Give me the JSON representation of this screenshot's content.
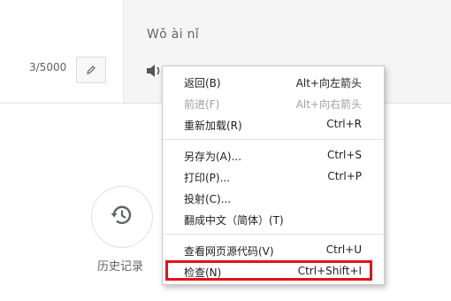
{
  "top": {
    "char_count": "3/5000",
    "pinyin": "Wǒ ài nǐ"
  },
  "icons": {
    "edit": "pencil-icon",
    "speaker": "speaker-icon",
    "history": "history-icon"
  },
  "history": {
    "label": "历史记录"
  },
  "context_menu": {
    "items": [
      {
        "label": "返回(B)",
        "shortcut": "Alt+向左箭头",
        "disabled": false
      },
      {
        "label": "前进(F)",
        "shortcut": "Alt+向右箭头",
        "disabled": true
      },
      {
        "label": "重新加载(R)",
        "shortcut": "Ctrl+R",
        "disabled": false
      },
      {
        "label": "另存为(A)...",
        "shortcut": "Ctrl+S",
        "disabled": false
      },
      {
        "label": "打印(P)...",
        "shortcut": "Ctrl+P",
        "disabled": false
      },
      {
        "label": "投射(C)...",
        "shortcut": "",
        "disabled": false
      },
      {
        "label": "翻成中文（简体）(T)",
        "shortcut": "",
        "disabled": false
      },
      {
        "label": "查看网页源代码(V)",
        "shortcut": "Ctrl+U",
        "disabled": false
      },
      {
        "label": "检查(N)",
        "shortcut": "Ctrl+Shift+I",
        "disabled": false
      }
    ]
  },
  "colors": {
    "highlight": "#e1131a",
    "accent": "#f2c200",
    "panel": "#f5f5f5"
  }
}
